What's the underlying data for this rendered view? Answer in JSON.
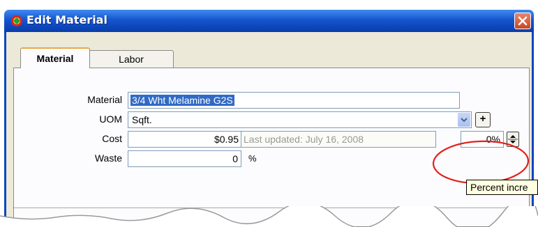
{
  "window": {
    "title": "Edit Material"
  },
  "tabs": [
    {
      "label": "Material",
      "active": true
    },
    {
      "label": "Labor",
      "active": false
    }
  ],
  "form": {
    "material_label": "Material",
    "material_value": "3/4 Wht Melamine G2S",
    "uom_label": "UOM",
    "uom_value": "Sqft.",
    "plus_label": "+",
    "cost_label": "Cost",
    "cost_value": "$0.95",
    "last_updated": "Last updated: July 16, 2008",
    "percent_value": "0%",
    "waste_label": "Waste",
    "waste_value": "0",
    "waste_unit": "%"
  },
  "tooltip": {
    "text": "Percent incre"
  },
  "colors": {
    "title_bar": "#1655cf",
    "selection": "#316ac5",
    "highlight_circle": "#e0211b"
  },
  "icons": [
    "app-icon",
    "close-icon",
    "chevron-down-icon",
    "spin-up-icon",
    "spin-down-icon"
  ]
}
